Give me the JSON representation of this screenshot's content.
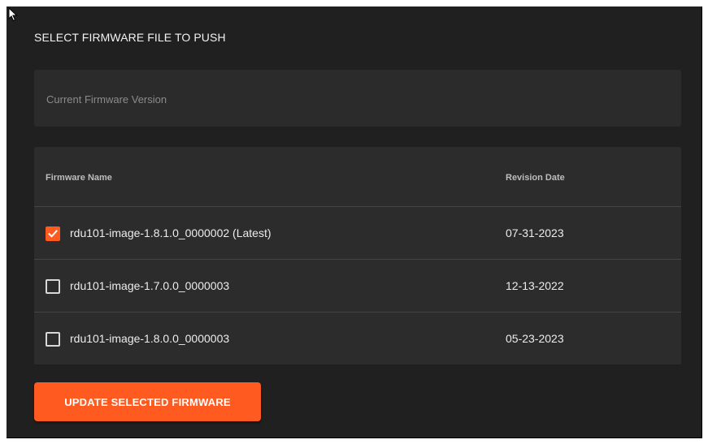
{
  "panel": {
    "title": "SELECT FIRMWARE FILE TO PUSH",
    "current_firmware_label": "Current Firmware Version"
  },
  "table": {
    "columns": [
      "Firmware Name",
      "Revision Date"
    ],
    "rows": [
      {
        "name": "rdu101-image-1.8.1.0_0000002 (Latest)",
        "date": "07-31-2023",
        "checked": true
      },
      {
        "name": "rdu101-image-1.7.0.0_0000003",
        "date": "12-13-2022",
        "checked": false
      },
      {
        "name": "rdu101-image-1.8.0.0_0000003",
        "date": "05-23-2023",
        "checked": false
      }
    ]
  },
  "actions": {
    "update_label": "UPDATE SELECTED FIRMWARE"
  },
  "icons": {
    "cursor": "mouse-pointer-icon",
    "checkmark": "checkmark-icon"
  },
  "colors": {
    "accent": "#ff5a1f",
    "panel_bg": "#202020",
    "row_bg": "#2c2c2c"
  }
}
